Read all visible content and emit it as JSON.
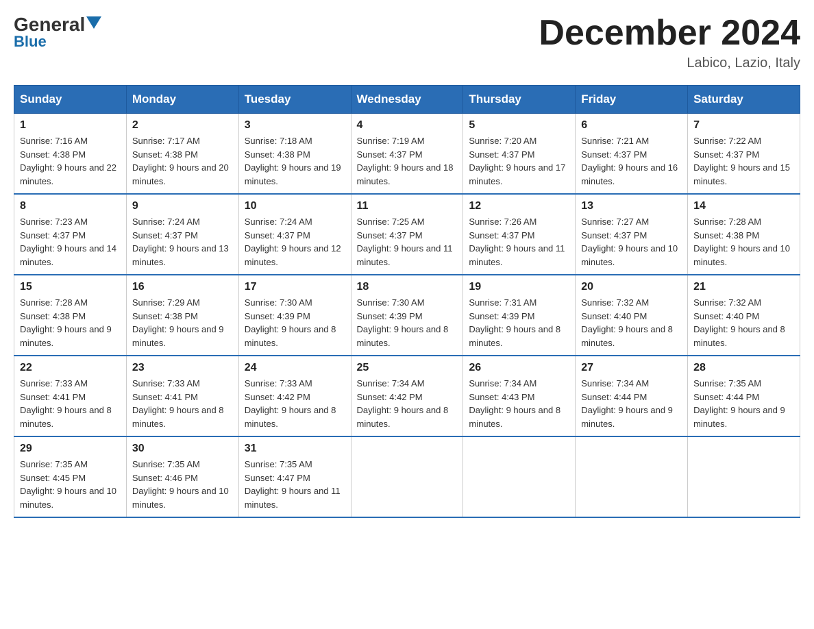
{
  "logo": {
    "text_general": "General",
    "text_blue": "Blue"
  },
  "header": {
    "month_year": "December 2024",
    "location": "Labico, Lazio, Italy"
  },
  "days_of_week": [
    "Sunday",
    "Monday",
    "Tuesday",
    "Wednesday",
    "Thursday",
    "Friday",
    "Saturday"
  ],
  "weeks": [
    [
      {
        "day": "1",
        "sunrise": "7:16 AM",
        "sunset": "4:38 PM",
        "daylight": "9 hours and 22 minutes."
      },
      {
        "day": "2",
        "sunrise": "7:17 AM",
        "sunset": "4:38 PM",
        "daylight": "9 hours and 20 minutes."
      },
      {
        "day": "3",
        "sunrise": "7:18 AM",
        "sunset": "4:38 PM",
        "daylight": "9 hours and 19 minutes."
      },
      {
        "day": "4",
        "sunrise": "7:19 AM",
        "sunset": "4:37 PM",
        "daylight": "9 hours and 18 minutes."
      },
      {
        "day": "5",
        "sunrise": "7:20 AM",
        "sunset": "4:37 PM",
        "daylight": "9 hours and 17 minutes."
      },
      {
        "day": "6",
        "sunrise": "7:21 AM",
        "sunset": "4:37 PM",
        "daylight": "9 hours and 16 minutes."
      },
      {
        "day": "7",
        "sunrise": "7:22 AM",
        "sunset": "4:37 PM",
        "daylight": "9 hours and 15 minutes."
      }
    ],
    [
      {
        "day": "8",
        "sunrise": "7:23 AM",
        "sunset": "4:37 PM",
        "daylight": "9 hours and 14 minutes."
      },
      {
        "day": "9",
        "sunrise": "7:24 AM",
        "sunset": "4:37 PM",
        "daylight": "9 hours and 13 minutes."
      },
      {
        "day": "10",
        "sunrise": "7:24 AM",
        "sunset": "4:37 PM",
        "daylight": "9 hours and 12 minutes."
      },
      {
        "day": "11",
        "sunrise": "7:25 AM",
        "sunset": "4:37 PM",
        "daylight": "9 hours and 11 minutes."
      },
      {
        "day": "12",
        "sunrise": "7:26 AM",
        "sunset": "4:37 PM",
        "daylight": "9 hours and 11 minutes."
      },
      {
        "day": "13",
        "sunrise": "7:27 AM",
        "sunset": "4:37 PM",
        "daylight": "9 hours and 10 minutes."
      },
      {
        "day": "14",
        "sunrise": "7:28 AM",
        "sunset": "4:38 PM",
        "daylight": "9 hours and 10 minutes."
      }
    ],
    [
      {
        "day": "15",
        "sunrise": "7:28 AM",
        "sunset": "4:38 PM",
        "daylight": "9 hours and 9 minutes."
      },
      {
        "day": "16",
        "sunrise": "7:29 AM",
        "sunset": "4:38 PM",
        "daylight": "9 hours and 9 minutes."
      },
      {
        "day": "17",
        "sunrise": "7:30 AM",
        "sunset": "4:39 PM",
        "daylight": "9 hours and 8 minutes."
      },
      {
        "day": "18",
        "sunrise": "7:30 AM",
        "sunset": "4:39 PM",
        "daylight": "9 hours and 8 minutes."
      },
      {
        "day": "19",
        "sunrise": "7:31 AM",
        "sunset": "4:39 PM",
        "daylight": "9 hours and 8 minutes."
      },
      {
        "day": "20",
        "sunrise": "7:32 AM",
        "sunset": "4:40 PM",
        "daylight": "9 hours and 8 minutes."
      },
      {
        "day": "21",
        "sunrise": "7:32 AM",
        "sunset": "4:40 PM",
        "daylight": "9 hours and 8 minutes."
      }
    ],
    [
      {
        "day": "22",
        "sunrise": "7:33 AM",
        "sunset": "4:41 PM",
        "daylight": "9 hours and 8 minutes."
      },
      {
        "day": "23",
        "sunrise": "7:33 AM",
        "sunset": "4:41 PM",
        "daylight": "9 hours and 8 minutes."
      },
      {
        "day": "24",
        "sunrise": "7:33 AM",
        "sunset": "4:42 PM",
        "daylight": "9 hours and 8 minutes."
      },
      {
        "day": "25",
        "sunrise": "7:34 AM",
        "sunset": "4:42 PM",
        "daylight": "9 hours and 8 minutes."
      },
      {
        "day": "26",
        "sunrise": "7:34 AM",
        "sunset": "4:43 PM",
        "daylight": "9 hours and 8 minutes."
      },
      {
        "day": "27",
        "sunrise": "7:34 AM",
        "sunset": "4:44 PM",
        "daylight": "9 hours and 9 minutes."
      },
      {
        "day": "28",
        "sunrise": "7:35 AM",
        "sunset": "4:44 PM",
        "daylight": "9 hours and 9 minutes."
      }
    ],
    [
      {
        "day": "29",
        "sunrise": "7:35 AM",
        "sunset": "4:45 PM",
        "daylight": "9 hours and 10 minutes."
      },
      {
        "day": "30",
        "sunrise": "7:35 AM",
        "sunset": "4:46 PM",
        "daylight": "9 hours and 10 minutes."
      },
      {
        "day": "31",
        "sunrise": "7:35 AM",
        "sunset": "4:47 PM",
        "daylight": "9 hours and 11 minutes."
      },
      null,
      null,
      null,
      null
    ]
  ]
}
